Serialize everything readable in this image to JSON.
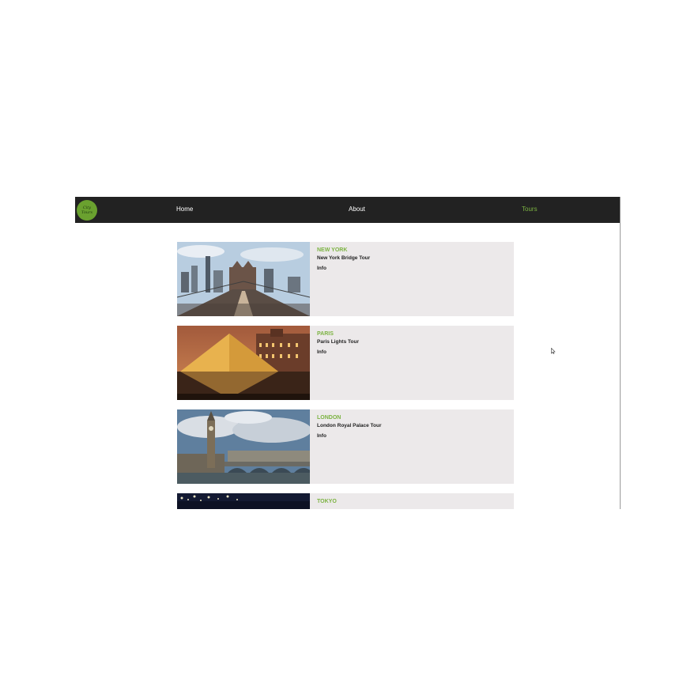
{
  "navbar": {
    "logo_text": "City Tours",
    "links": [
      {
        "label": "Home"
      },
      {
        "label": "About"
      },
      {
        "label": "Tours",
        "active": true
      }
    ]
  },
  "tours": [
    {
      "city": "NEW YORK",
      "title": "New York Bridge Tour",
      "info": "Info",
      "image": "brooklyn-bridge-photo"
    },
    {
      "city": "PARIS",
      "title": "Paris Lights Tour",
      "info": "Info",
      "image": "louvre-pyramid-photo"
    },
    {
      "city": "LONDON",
      "title": "London Royal Palace Tour",
      "info": "Info",
      "image": "big-ben-westminster-photo"
    },
    {
      "city": "TOKYO",
      "title": "",
      "info": "",
      "image": "tokyo-night-photo"
    }
  ],
  "colors": {
    "navbar_bg": "#222222",
    "accent": "#7cb342",
    "card_bg": "#ece9ea"
  }
}
